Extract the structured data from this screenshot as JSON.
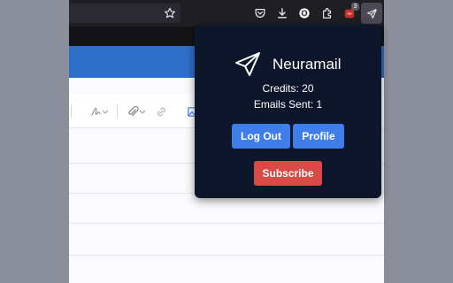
{
  "browser": {
    "toolbar_icons": [
      "star-icon",
      "pocket-icon",
      "download-icon",
      "extension-o-icon",
      "puzzle-icon",
      "extension-badge-icon",
      "paper-plane-icon"
    ],
    "extension_badge_count": "3",
    "extension_o_label": "O"
  },
  "popup": {
    "app_name": "Neuramail",
    "credits_text": "Credits: 20",
    "emails_sent_text": "Emails Sent: 1",
    "logout_label": "Log Out",
    "profile_label": "Profile",
    "subscribe_label": "Subscribe"
  },
  "colors": {
    "popup_bg": "#0d162b",
    "button_blue": "#3f7ee8",
    "button_red": "#d94a47",
    "brand_band": "#2f6ec6"
  }
}
